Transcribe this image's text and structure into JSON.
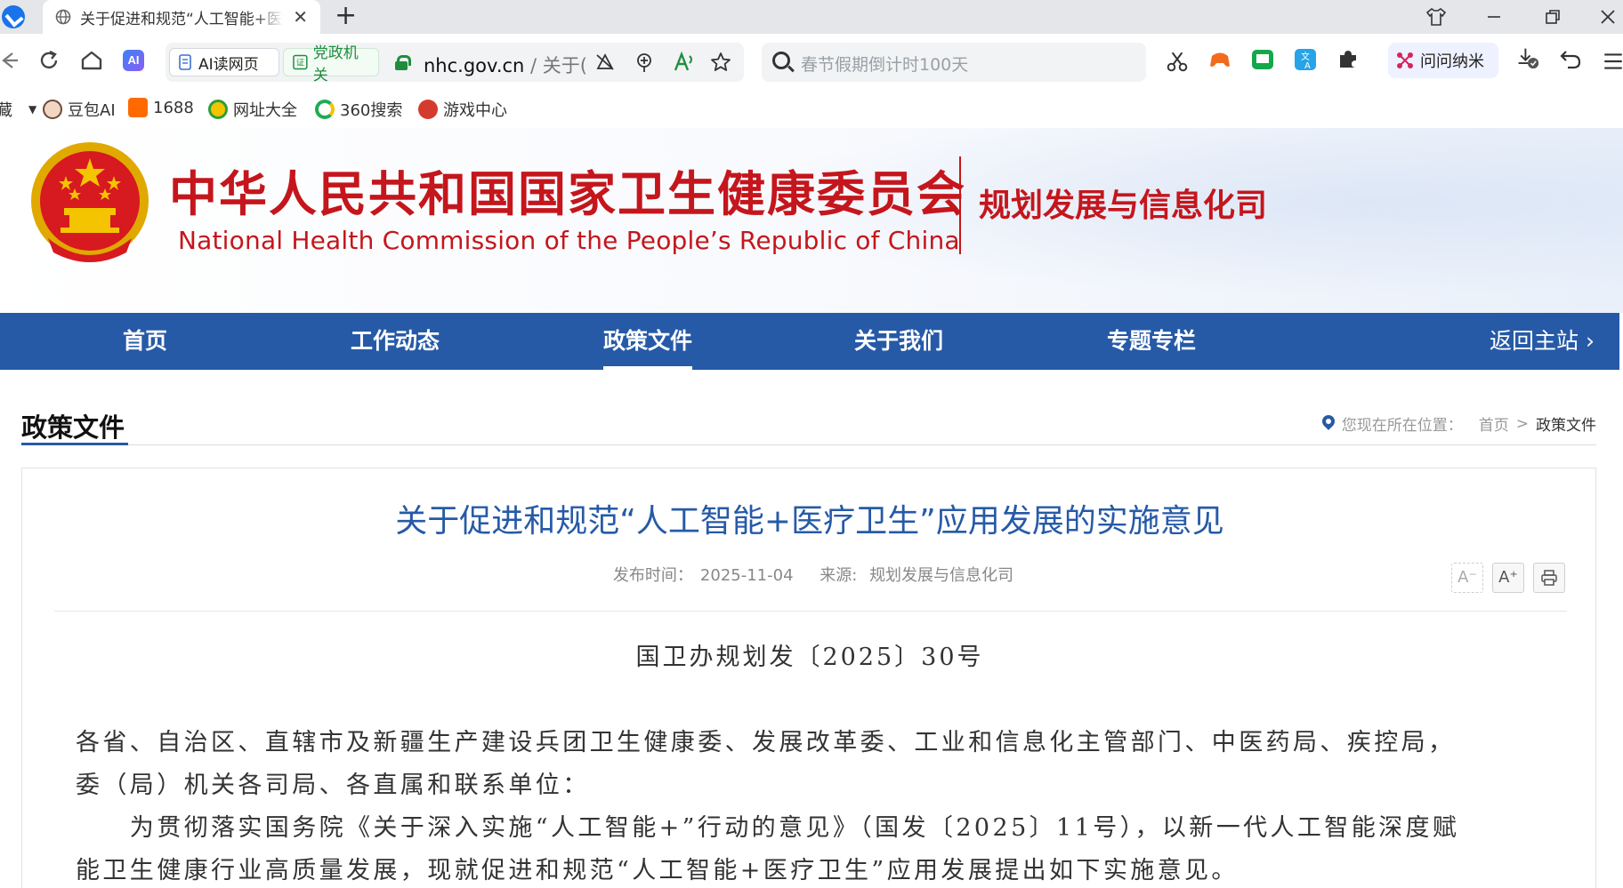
{
  "browser": {
    "tab_title": "关于促进和规范“人工智能+医疗卫生”应用发展的实施意见",
    "new_tab_symbol": "+",
    "tab_close_symbol": "✕",
    "ai_icon_text": "AI",
    "ai_read_label": "AI读网页",
    "gov_badge_label": "党政机关",
    "url_domain": "nhc.gov.cn",
    "url_path": " / 关于(",
    "search_placeholder": "春节假期倒计时100天",
    "assistant_label": "问问纳米",
    "icons": {
      "back": "arrow-left-icon",
      "reload": "reload-icon",
      "home": "home-icon",
      "star": "star-icon",
      "extensions": "puzzle-icon"
    }
  },
  "bookmarks": [
    {
      "label": "豆包AI",
      "color": "#6a5acd"
    },
    {
      "label": "1688",
      "color": "#ff6a00"
    },
    {
      "label": "网址大全",
      "color": "#2e9e3a"
    },
    {
      "label": "360搜索",
      "color": "#22aa55"
    },
    {
      "label": "游戏中心",
      "color": "#d43b2f"
    }
  ],
  "bookmarks_overflow": "藏",
  "site": {
    "name_cn": "中华人民共和国国家卫生健康委员会",
    "name_en": "National Health Commission of the People’s  Republic of China",
    "department": "规划发展与信息化司",
    "brand_red": "#c4161c",
    "brand_blue": "#265aa7"
  },
  "nav": {
    "items": [
      {
        "label": "首页"
      },
      {
        "label": "工作动态"
      },
      {
        "label": "政策文件"
      },
      {
        "label": "关于我们"
      },
      {
        "label": "专题专栏"
      }
    ],
    "active": "政策文件",
    "back_label": "返回主站 ›"
  },
  "section": {
    "title": "政策文件",
    "location_prefix": "您现在所在位置：",
    "crumb_home": "首页",
    "crumb_sep": ">",
    "crumb_current": "政策文件"
  },
  "article": {
    "title": "关于促进和规范“人工智能+医疗卫生”应用发展的实施意见",
    "publish_label": "发布时间：",
    "publish_date": "2025-11-04",
    "source_label": "来源: ",
    "source": "规划发展与信息化司",
    "font_smaller": "A⁻",
    "font_larger": "A⁺",
    "print_symbol": "⎙",
    "doc_number": "国卫办规划发〔2025〕30号",
    "paragraphs": [
      "各省、自治区、直辖市及新疆生产建设兵团卫生健康委、发展改革委、工业和信息化主管部门、中医药局、疾控局，",
      "委（局）机关各司局、各直属和联系单位：",
      "　　为贯彻落实国务院《关于深入实施“人工智能+”行动的意见》（国发〔2025〕11号），以新一代人工智能深度赋",
      "能卫生健康行业高质量发展，现就促进和规范“人工智能+医疗卫生”应用发展提出如下实施意见。"
    ]
  }
}
